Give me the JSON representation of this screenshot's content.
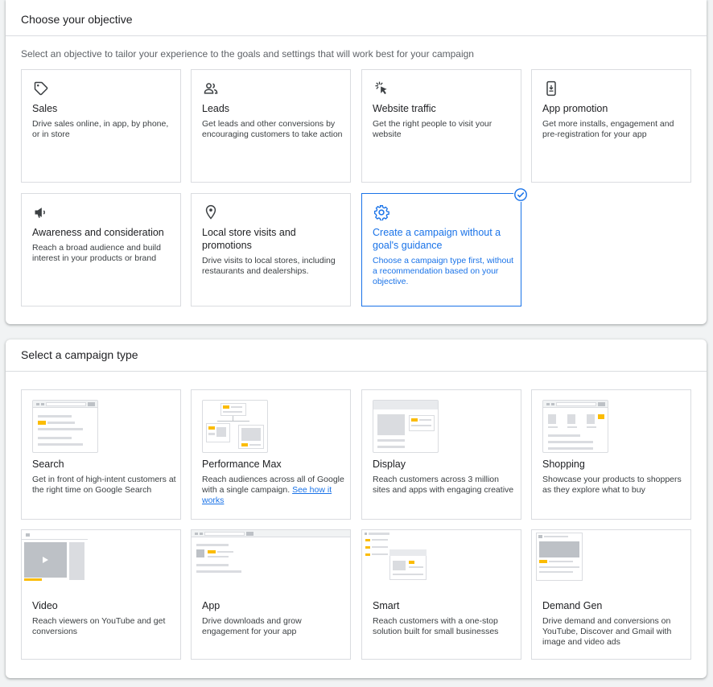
{
  "objective": {
    "title": "Choose your objective",
    "subtitle": "Select an objective to tailor your experience to the goals and settings that will work best for your campaign",
    "cards": [
      {
        "icon": "tag-icon",
        "title": "Sales",
        "desc": "Drive sales online, in app, by phone, or in store"
      },
      {
        "icon": "people-icon",
        "title": "Leads",
        "desc": "Get leads and other conversions by encouraging customers to take action"
      },
      {
        "icon": "cursor-click-icon",
        "title": "Website traffic",
        "desc": "Get the right people to visit your website"
      },
      {
        "icon": "phone-download-icon",
        "title": "App promotion",
        "desc": "Get more installs, engagement and pre-registration for your app"
      },
      {
        "icon": "megaphone-icon",
        "title": "Awareness and consideration",
        "desc": "Reach a broad audience and build interest in your products or brand"
      },
      {
        "icon": "location-pin-icon",
        "title": "Local store visits and promotions",
        "desc": "Drive visits to local stores, including restaurants and dealerships."
      },
      {
        "icon": "gear-icon",
        "title": "Create a campaign without a goal's guidance",
        "desc": "Choose a campaign type first, without a recommendation based on your objective.",
        "selected": true
      }
    ]
  },
  "campaign_type": {
    "title": "Select a campaign type",
    "cards": [
      {
        "title": "Search",
        "desc": "Get in front of high-intent customers at the right time on Google Search"
      },
      {
        "title": "Performance Max",
        "desc": "Reach audiences across all of Google with a single campaign.",
        "link": "See how it works"
      },
      {
        "title": "Display",
        "desc": "Reach customers across 3 million sites and apps with engaging creative"
      },
      {
        "title": "Shopping",
        "desc": "Showcase your products to shoppers as they explore what to buy"
      },
      {
        "title": "Video",
        "desc": "Reach viewers on YouTube and get conversions"
      },
      {
        "title": "App",
        "desc": "Drive downloads and grow engagement for your app"
      },
      {
        "title": "Smart",
        "desc": "Reach customers with a one-stop solution built for small businesses"
      },
      {
        "title": "Demand Gen",
        "desc": "Drive demand and conversions on YouTube, Discover and Gmail with image and video ads"
      }
    ]
  },
  "colors": {
    "accent": "#1a73e8",
    "highlight": "#fbbc04",
    "border": "#dadce0"
  }
}
